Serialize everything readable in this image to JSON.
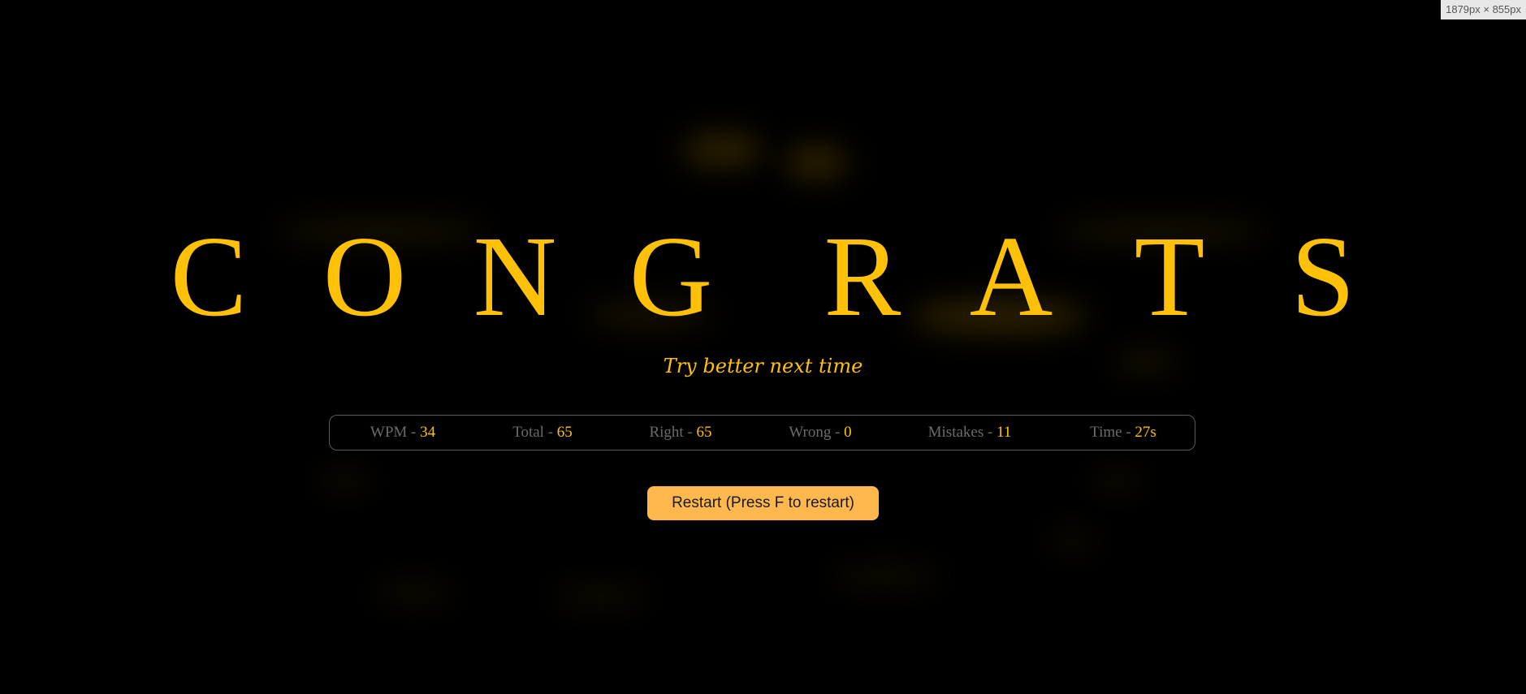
{
  "viewport_badge": "1879px × 855px",
  "headline": {
    "letters": [
      "C",
      "O",
      "N",
      "G",
      "R",
      "A",
      "T",
      "S"
    ]
  },
  "subtitle": "Try better next time",
  "stats": [
    {
      "label": "WPM - ",
      "value": "34"
    },
    {
      "label": "Total - ",
      "value": "65"
    },
    {
      "label": "Right - ",
      "value": "65"
    },
    {
      "label": "Wrong - ",
      "value": "0"
    },
    {
      "label": "Mistakes - ",
      "value": "11"
    },
    {
      "label": "Time - ",
      "value": "27s"
    }
  ],
  "restart_button": {
    "label": "Restart (Press F to restart)"
  },
  "colors": {
    "background": "#000000",
    "accent": "#ffc107",
    "muted_label": "#6b6b6b",
    "button_bg": "#ffb84d",
    "border": "#5a5a5a"
  }
}
